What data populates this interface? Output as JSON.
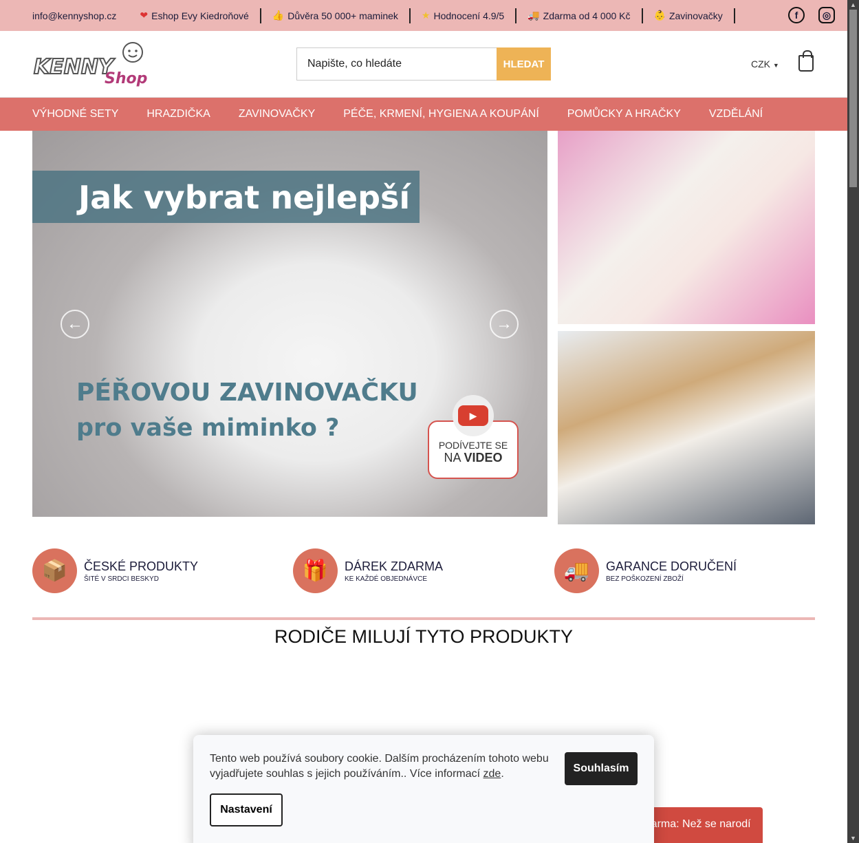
{
  "topbar": {
    "email": "info@kennyshop.cz",
    "items": [
      {
        "icon": "heart-icon",
        "label": "Eshop Evy Kiedroňové"
      },
      {
        "icon": "thumbs-up-icon",
        "label": "Důvěra 50 000+ maminek"
      },
      {
        "icon": "star-icon",
        "label": "Hodnocení 4.9/5"
      },
      {
        "icon": "truck-icon",
        "label": "Zdarma od 4 000 Kč"
      },
      {
        "icon": "baby-icon",
        "label": "Zavinovačky"
      }
    ],
    "social": [
      "facebook-icon",
      "instagram-icon"
    ]
  },
  "header": {
    "logo_text": "KENNY Shop",
    "search_placeholder": "Napište, co hledáte",
    "search_button": "HLEDAT",
    "currency": "CZK"
  },
  "nav": [
    "VÝHODNÉ SETY",
    "HRAZDIČKA",
    "ZAVINOVAČKY",
    "PÉČE, KRMENÍ, HYGIENA A KOUPÁNÍ",
    "POMŮCKY A HRAČKY",
    "VZDĚLÁNÍ"
  ],
  "hero": {
    "title": "Jak vybrat nejlepší",
    "line1": "PÉŘOVOU ZAVINOVAČKU",
    "line2": "pro vaše miminko ?",
    "video_line1": "PODÍVEJTE SE",
    "video_line2_pre": "NA ",
    "video_line2_bold": "VIDEO"
  },
  "features": [
    {
      "icon": "box-icon",
      "title": "ČESKÉ PRODUKTY",
      "subtitle": "ŠITÉ V SRDCI BESKYD"
    },
    {
      "icon": "gift-icon",
      "title": "DÁREK ZDARMA",
      "subtitle": "KE KAŽDÉ OBJEDNÁVCE"
    },
    {
      "icon": "delivery-shield-icon",
      "title": "GARANCE DORUČENÍ",
      "subtitle": "BEZ POŠKOZENÍ ZBOŽÍ"
    }
  ],
  "section_title": "RODIČE MILUJÍ TYTO PRODUKTY",
  "cookie": {
    "text": "Tento web používá soubory cookie. Dalším procházením tohoto webu vyjadřujete souhlas s jejich používáním.. Více informací ",
    "link": "zde",
    "after": ".",
    "agree": "Souhlasím",
    "settings": "Nastavení"
  },
  "promo": "Zdarma: Než se narodí",
  "colors": {
    "topbar": "#ecb7b5",
    "nav": "#dc716b",
    "search_button": "#eeb356",
    "feature_icon": "#d9725e",
    "promo": "#d04a40"
  }
}
